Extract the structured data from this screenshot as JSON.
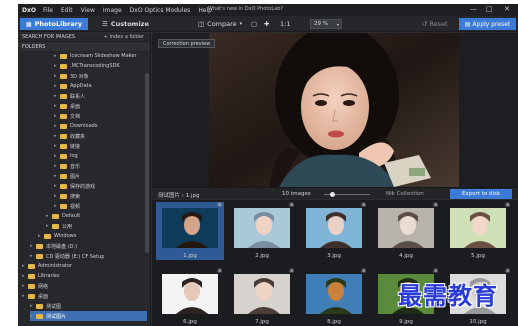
{
  "menubar": {
    "logo": "DxO",
    "items": [
      "File",
      "Edit",
      "View",
      "Image",
      "DxO Optics Modules",
      "Help"
    ],
    "window_title": "What's new in DxO PhotoLab?",
    "controls": [
      "—",
      "□",
      "✕"
    ]
  },
  "toolbar": {
    "photolibrary": "PhotoLibrary",
    "customize": "Customize",
    "compare": "Compare",
    "ratio": "1:1",
    "zoom": "29 %",
    "reset": "Reset",
    "apply_preset": "Apply preset"
  },
  "sidebar": {
    "search_label": "SEARCH FOR IMAGES",
    "index_label": "+ Index a folder",
    "folders_label": "FOLDERS",
    "tree": [
      {
        "label": "Icecream Slideshow Maker",
        "level": 4
      },
      {
        "label": ".MCTranscodingSDK",
        "level": 4
      },
      {
        "label": "3D 对象",
        "level": 4
      },
      {
        "label": "AppData",
        "level": 4
      },
      {
        "label": "联系人",
        "level": 4
      },
      {
        "label": "桌面",
        "level": 4
      },
      {
        "label": "文档",
        "level": 4
      },
      {
        "label": "Downloads",
        "level": 4
      },
      {
        "label": "收藏夹",
        "level": 4
      },
      {
        "label": "链接",
        "level": 4
      },
      {
        "label": "log",
        "level": 4
      },
      {
        "label": "音乐",
        "level": 4
      },
      {
        "label": "图片",
        "level": 4
      },
      {
        "label": "保存的游戏",
        "level": 4
      },
      {
        "label": "搜索",
        "level": 4
      },
      {
        "label": "视频",
        "level": 4
      },
      {
        "label": "Default",
        "level": 3
      },
      {
        "label": "公用",
        "level": 3
      },
      {
        "label": "Windows",
        "level": 2
      },
      {
        "label": "本地磁盘 (D:)",
        "level": 1
      },
      {
        "label": "CD 驱动器 (E:) CF Setup",
        "level": 1
      },
      {
        "label": "Administrator",
        "level": 0
      },
      {
        "label": "Libraries",
        "level": 0
      },
      {
        "label": "网络",
        "level": 0
      },
      {
        "label": "桌面",
        "level": 0
      },
      {
        "label": "测试图",
        "level": 1
      },
      {
        "label": "测试图片",
        "level": 1
      }
    ]
  },
  "viewer": {
    "correction_preview": "Correction preview"
  },
  "filmstrip_bar": {
    "breadcrumb": "测试图片 › 1.jpg",
    "count": "10 images",
    "nik": "Nik Collection",
    "export": "Export to disk"
  },
  "thumbnails": [
    {
      "label": "1.jpg",
      "selected": true
    },
    {
      "label": "2.jpg",
      "selected": false
    },
    {
      "label": "3.jpg",
      "selected": false
    },
    {
      "label": "4.jpg",
      "selected": false
    },
    {
      "label": "5.jpg",
      "selected": false
    },
    {
      "label": "6.jpg",
      "selected": false
    },
    {
      "label": "7.jpg",
      "selected": false
    },
    {
      "label": "8.jpg",
      "selected": false
    },
    {
      "label": "9.jpg",
      "selected": false
    },
    {
      "label": "10.jpg",
      "selected": false
    }
  ],
  "watermark": "最需教育",
  "colors": {
    "accent": "#3b7ad6",
    "selection": "#2e5a95",
    "background": "#2b2d31"
  }
}
